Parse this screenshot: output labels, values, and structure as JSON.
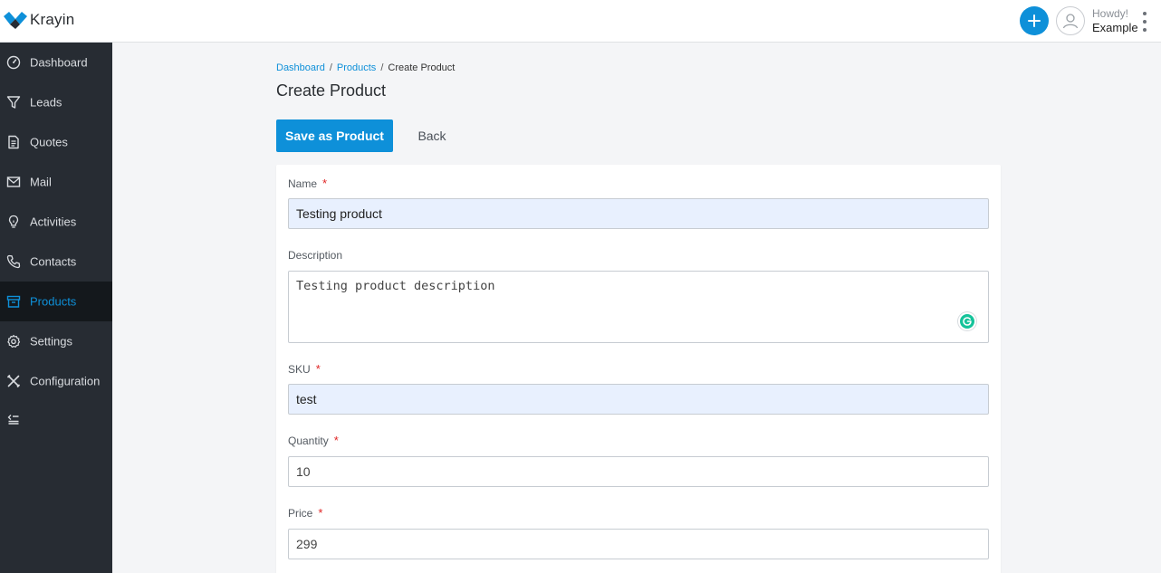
{
  "app": {
    "brand": "Krayin",
    "accent_color": "#0e90d9",
    "sidebar_color": "#272c33"
  },
  "header": {
    "greeting": "Howdy!",
    "user_name": "Example",
    "add_icon": "plus-icon",
    "avatar_icon": "user-avatar-icon",
    "menu_icon": "kebab-menu-icon"
  },
  "sidebar": {
    "items": [
      {
        "label": "Dashboard",
        "icon": "dashboard-icon"
      },
      {
        "label": "Leads",
        "icon": "filter-icon"
      },
      {
        "label": "Quotes",
        "icon": "document-icon"
      },
      {
        "label": "Mail",
        "icon": "mail-icon"
      },
      {
        "label": "Activities",
        "icon": "lightbulb-icon"
      },
      {
        "label": "Contacts",
        "icon": "phone-icon"
      },
      {
        "label": "Products",
        "icon": "box-icon"
      },
      {
        "label": "Settings",
        "icon": "gear-icon"
      },
      {
        "label": "Configuration",
        "icon": "tools-icon"
      }
    ],
    "active": "Products",
    "collapse_icon": "collapse-menu-icon"
  },
  "breadcrumb": {
    "items": [
      "Dashboard",
      "Products",
      "Create Product"
    ],
    "separator": "/"
  },
  "page": {
    "title": "Create Product",
    "save_label": "Save as Product",
    "back_label": "Back"
  },
  "form": {
    "name": {
      "label": "Name",
      "required": "*",
      "value": "Testing product"
    },
    "description": {
      "label": "Description",
      "value": "Testing product description"
    },
    "sku": {
      "label": "SKU",
      "required": "*",
      "value": "test"
    },
    "quantity": {
      "label": "Quantity",
      "required": "*",
      "value": "10"
    },
    "price": {
      "label": "Price",
      "required": "*",
      "value": "299"
    }
  }
}
